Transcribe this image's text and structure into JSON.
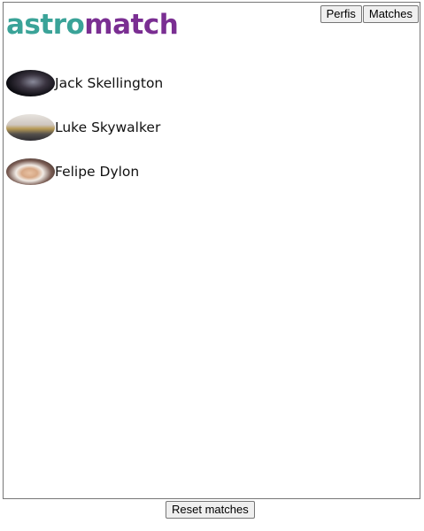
{
  "header": {
    "logo": {
      "part1": "astro",
      "part2": "match"
    },
    "nav": {
      "perfis_label": "Perfis",
      "matches_label": "Matches"
    }
  },
  "matches": [
    {
      "name": "Jack Skellington"
    },
    {
      "name": "Luke Skywalker"
    },
    {
      "name": "Felipe Dylon"
    }
  ],
  "footer": {
    "reset_label": "Reset matches"
  },
  "colors": {
    "logo_teal": "#3aa398",
    "logo_purple": "#7a2e92",
    "card_border": "#777777"
  }
}
